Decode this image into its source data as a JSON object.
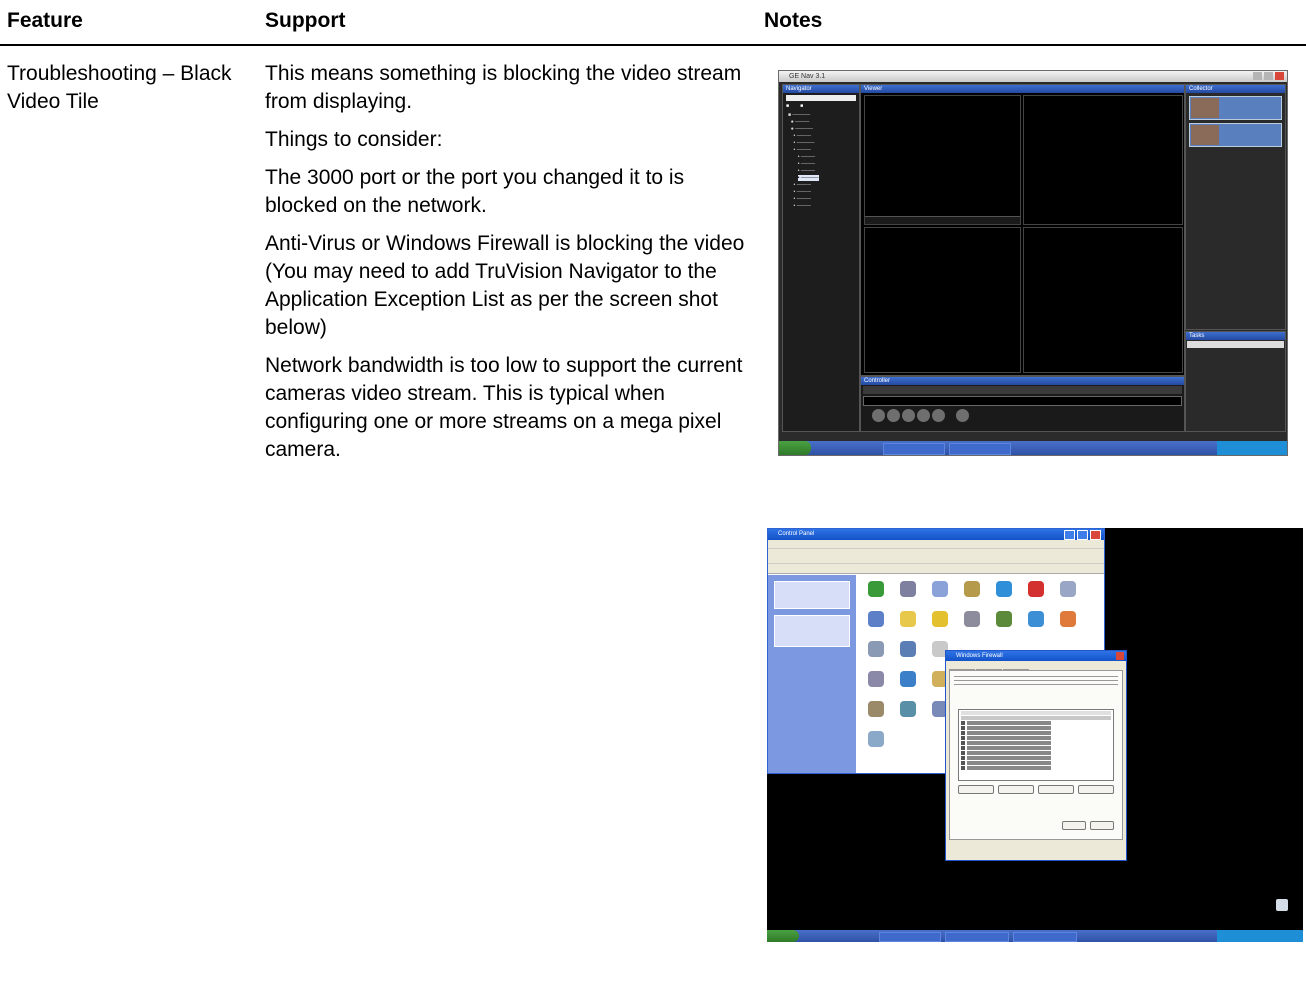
{
  "headers": {
    "feature": "Feature",
    "support": "Support",
    "notes": "Notes"
  },
  "row": {
    "feature": "Troubleshooting – Black Video Tile",
    "support": [
      "This means something is blocking the video stream from displaying.",
      "Things to consider:",
      "The 3000 port or the port you changed it to is blocked on the network.",
      "Anti-Virus or Windows Firewall is blocking the video (You may need to add TruVision Navigator to the Application Exception List as per the screen shot below)",
      "Network bandwidth is too low to support the current cameras video stream. This is typical when configuring one or more streams on a mega pixel camera."
    ]
  },
  "screenshot1": {
    "title": "GE Nav 3.1",
    "navigator": "Navigator",
    "viewer": "Viewer",
    "collector": "Collector",
    "controller": "Controller",
    "tasks": "Tasks"
  },
  "screenshot2": {
    "cp_title": "Control Panel",
    "fw_title": "Windows Firewall"
  }
}
